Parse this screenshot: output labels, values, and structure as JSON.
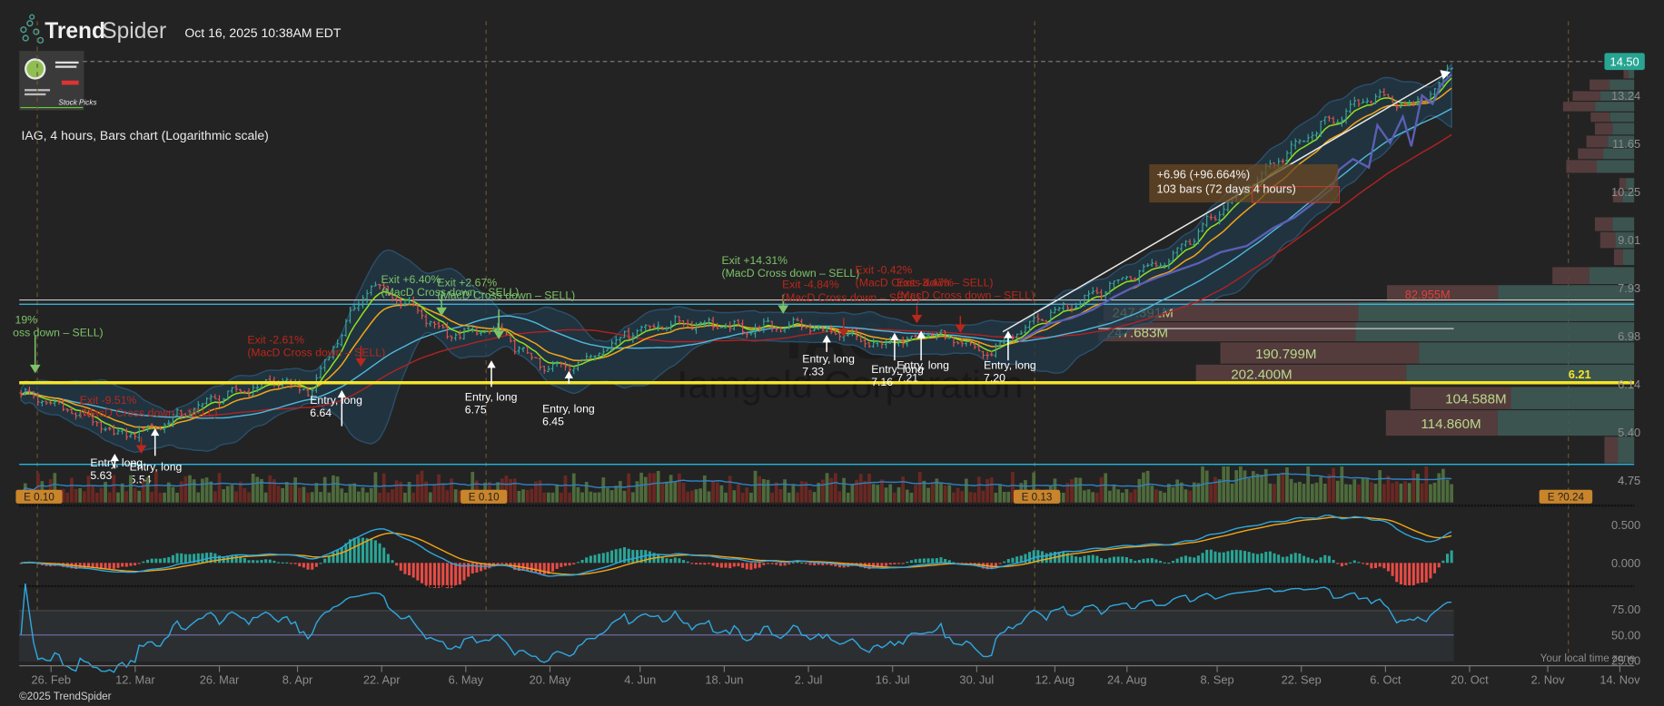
{
  "header": {
    "brand_bold": "Trend",
    "brand_light": "Spider",
    "timestamp": "Oct 16, 2025 10:38AM EDT",
    "thumbnail_text": "Stock Picks"
  },
  "chart_title": "IAG, 4 hours, Bars chart (Logarithmic scale)",
  "watermark": {
    "ticker": "IAG",
    "company": "Iamgold Corporation"
  },
  "footer": {
    "copyright": "©2025 TrendSpider",
    "timezone_note": "Your local time zone"
  },
  "colors": {
    "background": "#232323",
    "up": "#3aa597",
    "down": "#e0534f",
    "ema_fast": "#8fe01f",
    "ema_slow": "#f2a516",
    "sma_mid": "#4fb9dc",
    "sma_long": "#b32222",
    "bands": "#2b4f6b",
    "support_line": "#f5e52a",
    "last_price_badge": "#27a592",
    "earnings_badge": "#c9852b",
    "exit_win": "#7cc36a",
    "exit_loss": "#b8281c"
  },
  "chart_data": {
    "type": "bar",
    "title": "IAG, 4 hours, Bars chart (Logarithmic scale)",
    "scale": "logarithmic",
    "ylim": [
      4.6,
      14.6
    ],
    "price_path_note": "[day offset from 26 Feb 2025, price]",
    "price_path": [
      [
        -5,
        6.0
      ],
      [
        4,
        5.7
      ],
      [
        11,
        5.35
      ],
      [
        18,
        5.5
      ],
      [
        27,
        5.9
      ],
      [
        38,
        6.2
      ],
      [
        43,
        6.0
      ],
      [
        48,
        7.0
      ],
      [
        53,
        8.0
      ],
      [
        58,
        7.7
      ],
      [
        66,
        7.0
      ],
      [
        74,
        7.1
      ],
      [
        82,
        6.4
      ],
      [
        88,
        6.5
      ],
      [
        97,
        7.1
      ],
      [
        106,
        7.25
      ],
      [
        115,
        7.1
      ],
      [
        124,
        7.2
      ],
      [
        131,
        7.0
      ],
      [
        138,
        6.8
      ],
      [
        146,
        7.05
      ],
      [
        156,
        6.65
      ],
      [
        160,
        7.0
      ],
      [
        168,
        7.5
      ],
      [
        186,
        8.6
      ],
      [
        203,
        11.0
      ],
      [
        212,
        12.3
      ],
      [
        221,
        13.3
      ],
      [
        226,
        12.8
      ],
      [
        230,
        13.4
      ],
      [
        233,
        14.4
      ]
    ],
    "last_price": "14.50",
    "price_ticks": [
      "13.24",
      "11.65",
      "10.25",
      "9.01",
      "7.93",
      "6.98",
      "6.14",
      "5.40",
      "4.75"
    ],
    "price_tick_values": [
      13.24,
      11.65,
      10.25,
      9.01,
      7.93,
      6.98,
      6.14,
      5.4,
      4.75
    ],
    "x_ticks": [
      {
        "label": "26. Feb",
        "day": 0
      },
      {
        "label": "12. Mar",
        "day": 14
      },
      {
        "label": "26. Mar",
        "day": 28
      },
      {
        "label": "8. Apr",
        "day": 41
      },
      {
        "label": "22. Apr",
        "day": 55
      },
      {
        "label": "6. May",
        "day": 69
      },
      {
        "label": "20. May",
        "day": 83
      },
      {
        "label": "4. Jun",
        "day": 98
      },
      {
        "label": "18. Jun",
        "day": 112
      },
      {
        "label": "2. Jul",
        "day": 126
      },
      {
        "label": "16. Jul",
        "day": 140
      },
      {
        "label": "30. Jul",
        "day": 154
      },
      {
        "label": "12. Aug",
        "day": 167
      },
      {
        "label": "24. Aug",
        "day": 179
      },
      {
        "label": "8. Sep",
        "day": 194
      },
      {
        "label": "22. Sep",
        "day": 208
      },
      {
        "label": "6. Oct",
        "day": 222
      },
      {
        "label": "20. Oct",
        "day": 236
      },
      {
        "label": "2. Nov",
        "day": 249
      },
      {
        "label": "14. Nov",
        "day": 261
      }
    ],
    "support_level": {
      "label": "6.21",
      "value": 6.21
    },
    "indicators": [
      "EMA fast",
      "EMA slow",
      "SMA 50",
      "SMA 200",
      "Bollinger Bands",
      "Volume",
      "MACD",
      "RSI"
    ],
    "macd_ticks": [
      {
        "label": "0.500",
        "value": 0.5
      },
      {
        "label": "0.000",
        "value": 0
      }
    ],
    "rsi_ticks": [
      {
        "label": "75.00",
        "value": 75
      },
      {
        "label": "50.00",
        "value": 50
      },
      {
        "label": "25.00",
        "value": 25
      }
    ],
    "earnings": [
      {
        "label": "E 0.10",
        "day": -2
      },
      {
        "label": "E 0.10",
        "day": 72
      },
      {
        "label": "E 0.13",
        "day": 164
      },
      {
        "label": "E ?0.24",
        "day": 252
      }
    ],
    "volume_profile": [
      {
        "label": "82.955M",
        "value_m": 82.955
      },
      {
        "label": "247.391M",
        "value_m": 247.391
      },
      {
        "label": "247.683M",
        "value_m": 247.683
      },
      {
        "label": "190.799M",
        "value_m": 190.799
      },
      {
        "label": "202.400M",
        "value_m": 202.4
      },
      {
        "label": "104.588M",
        "value_m": 104.588
      },
      {
        "label": "114.860M",
        "value_m": 114.86
      }
    ],
    "measurement": {
      "line1": "+6.96 (+96.664%)",
      "line2": "103 bars (72 days 4 hours)"
    },
    "entries": [
      {
        "title": "Entry, long",
        "price": "5.63"
      },
      {
        "title": "Entry, long",
        "price": "5.54"
      },
      {
        "title": "Entry, long",
        "price": "6.64"
      },
      {
        "title": "Entry, long",
        "price": "6.75"
      },
      {
        "title": "Entry, long",
        "price": "6.45"
      },
      {
        "title": "Entry, long",
        "price": "7.33"
      },
      {
        "title": "Entry, long",
        "price": "7.16"
      },
      {
        "title": "Entry, long",
        "price": "7.21"
      },
      {
        "title": "Entry, long",
        "price": "7.20"
      }
    ],
    "exits": [
      {
        "title": "19%",
        "reason": "oss down – SELL)",
        "win": true
      },
      {
        "title": "Exit -9.51%",
        "reason": "(MacD Cross down – SELL)",
        "win": false
      },
      {
        "title": "Exit -2.61%",
        "reason": "(MacD Cross down – SELL)",
        "win": false
      },
      {
        "title": "Exit +6.40%",
        "reason": "(MacD Cross down – SELL)",
        "win": true
      },
      {
        "title": "Exit +2.67%",
        "reason": "(MacD Cross down – SELL)",
        "win": true
      },
      {
        "title": "Exit +14.31%",
        "reason": "(MacD Cross down – SELL)",
        "win": true
      },
      {
        "title": "Exit -4.84%",
        "reason": "(MacD Cross down – SELL)",
        "win": false
      },
      {
        "title": "Exit -0.42%",
        "reason": "(MacD Cross down – SELL)",
        "win": false
      },
      {
        "title": "Exit -3.47%",
        "reason": "(MacD Cross down – SELL)",
        "win": false
      }
    ]
  }
}
